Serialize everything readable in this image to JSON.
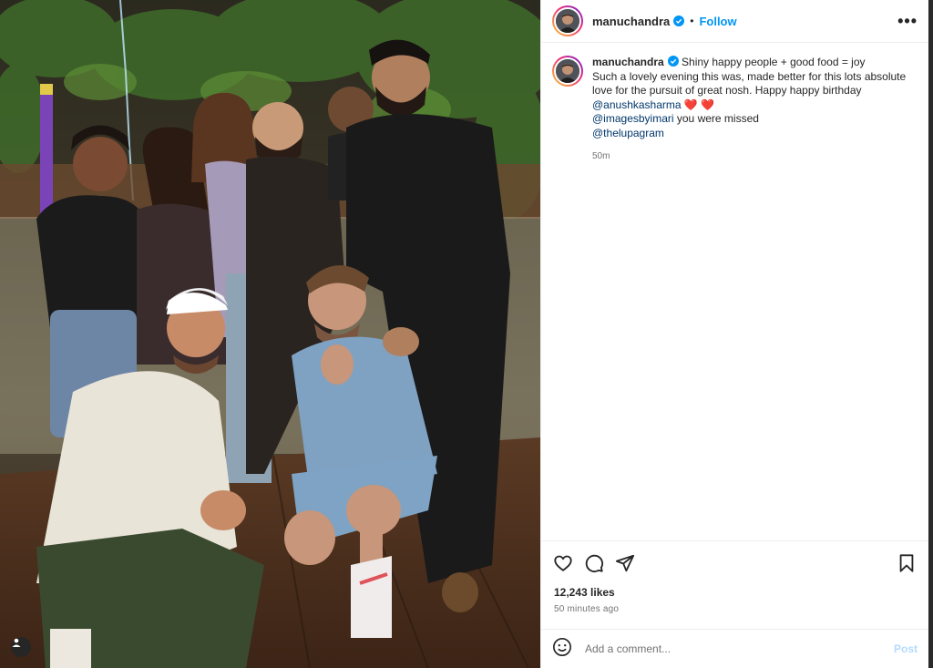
{
  "post": {
    "author": {
      "username": "manuchandra",
      "verified": true,
      "follow_label": "Follow",
      "separator": "•"
    },
    "more_label": "•••",
    "caption": {
      "username": "manuchandra",
      "line1": "Shiny happy people + good food = joy",
      "line2": "Such a lovely evening this was, made better for this lots absolute love for the pursuit of great nosh. Happy happy birthday",
      "mention1": "@anushkasharma",
      "hearts": "❤️ ❤️",
      "mention2": "@imagesbyimari",
      "line3": " you were missed",
      "mention3": "@thelupagram",
      "time": "50m"
    },
    "likes": "12,243 likes",
    "posted_ago": "50 minutes ago",
    "comment": {
      "placeholder": "Add a comment...",
      "post_label": "Post"
    },
    "icons": {
      "like": "heart-icon",
      "comment": "comment-bubble-icon",
      "share": "paper-plane-icon",
      "save": "bookmark-icon",
      "emoji": "smiley-icon",
      "tags": "user-tag-icon"
    },
    "colors": {
      "accent": "#0095f6",
      "mention": "#00376b",
      "heart": "#e0241b",
      "post_disabled": "#b3dbff"
    }
  }
}
